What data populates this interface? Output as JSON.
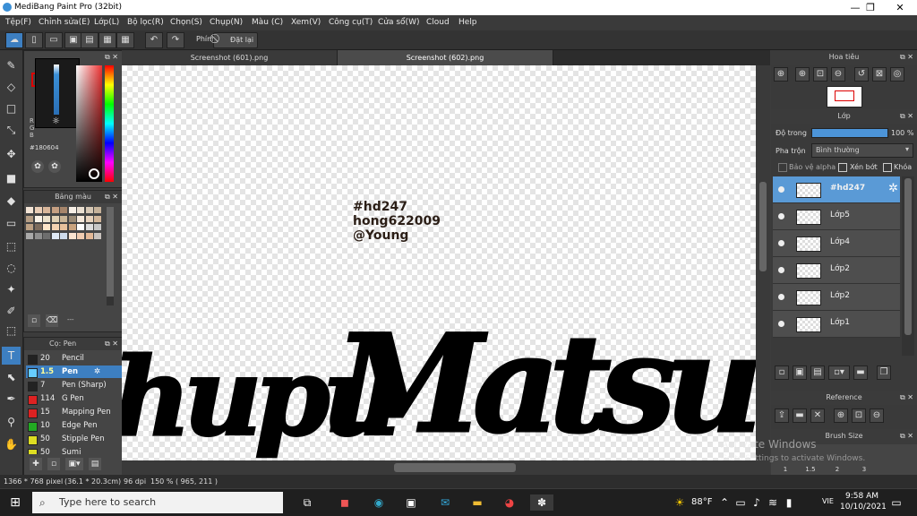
{
  "window": {
    "title": "MediBang Paint Pro (32bit)",
    "minimize": "—",
    "maximize": "❐",
    "close": "✕"
  },
  "menu": [
    "Tệp(F)",
    "Chỉnh sửa(E)",
    "Lớp(L)",
    "Bộ lọc(R)",
    "Chọn(S)",
    "Chụp(N)",
    "Màu (C)",
    "Xem(V)",
    "Công cụ(T)",
    "Cửa sổ(W)",
    "Cloud",
    "Help"
  ],
  "toolbar": {
    "shortcut_label": "Phím",
    "reset_label": "Đặt lại"
  },
  "color_panel": {
    "hex": "#180604",
    "r": "R",
    "g": "G",
    "b": "B"
  },
  "palette_panel": {
    "title": "Bảng màu",
    "footer": "---"
  },
  "brush_panel": {
    "title": "Cọ: Pen",
    "items": [
      {
        "size": "20",
        "name": "Pencil",
        "color": "#222222"
      },
      {
        "size": "1.5",
        "name": "Pen",
        "color": "#66ccff",
        "selected": true
      },
      {
        "size": "7",
        "name": "Pen (Sharp)",
        "color": "#222222"
      },
      {
        "size": "114",
        "name": "G Pen",
        "color": "#dd2222"
      },
      {
        "size": "15",
        "name": "Mapping Pen",
        "color": "#dd2222"
      },
      {
        "size": "10",
        "name": "Edge Pen",
        "color": "#22aa22"
      },
      {
        "size": "50",
        "name": "Stipple Pen",
        "color": "#dddd22"
      },
      {
        "size": "50",
        "name": "Sumi",
        "color": "#dddd22"
      }
    ]
  },
  "tabs": [
    "Screenshot (601).png",
    "Screenshot (602).png"
  ],
  "canvas": {
    "caption_lines": [
      "#hd247",
      "hong622009",
      "@Young"
    ],
    "script_left": "hupu",
    "script_right": "Matsumo"
  },
  "navigator": {
    "title": "Hoa tiêu"
  },
  "layer_panel": {
    "title": "Lớp",
    "opacity_label": "Độ trong",
    "opacity_value": "100 %",
    "blend_label": "Pha trộn",
    "blend_value": "Bình thường",
    "protect_alpha": "Bảo vệ alpha",
    "clipping": "Xén bớt",
    "lock": "Khóa",
    "layers": [
      "#hd247",
      "Lớp5",
      "Lớp4",
      "Lớp2",
      "Lớp2",
      "Lớp1"
    ]
  },
  "reference_panel": {
    "title": "Reference"
  },
  "brush_size_panel": {
    "title": "Brush Size",
    "sizes": [
      "1",
      "1.5",
      "2",
      "3"
    ]
  },
  "watermark": {
    "line1": "Activate Windows",
    "line2": "Go to Settings to activate Windows."
  },
  "status": {
    "size": "1366 * 768 pixel",
    "cm": "(36.1 * 20.3cm)",
    "dpi": "96 dpi",
    "zoom": "150 %",
    "coords": "( 965, 211 )"
  },
  "taskbar": {
    "search_placeholder": "Type here to search",
    "weather": "88°F",
    "lang": "VIE",
    "time": "9:58 AM",
    "date": "10/10/2021"
  },
  "colors": {
    "accent": "#3d7fc1",
    "selected_layer": "#5a9ad6"
  }
}
